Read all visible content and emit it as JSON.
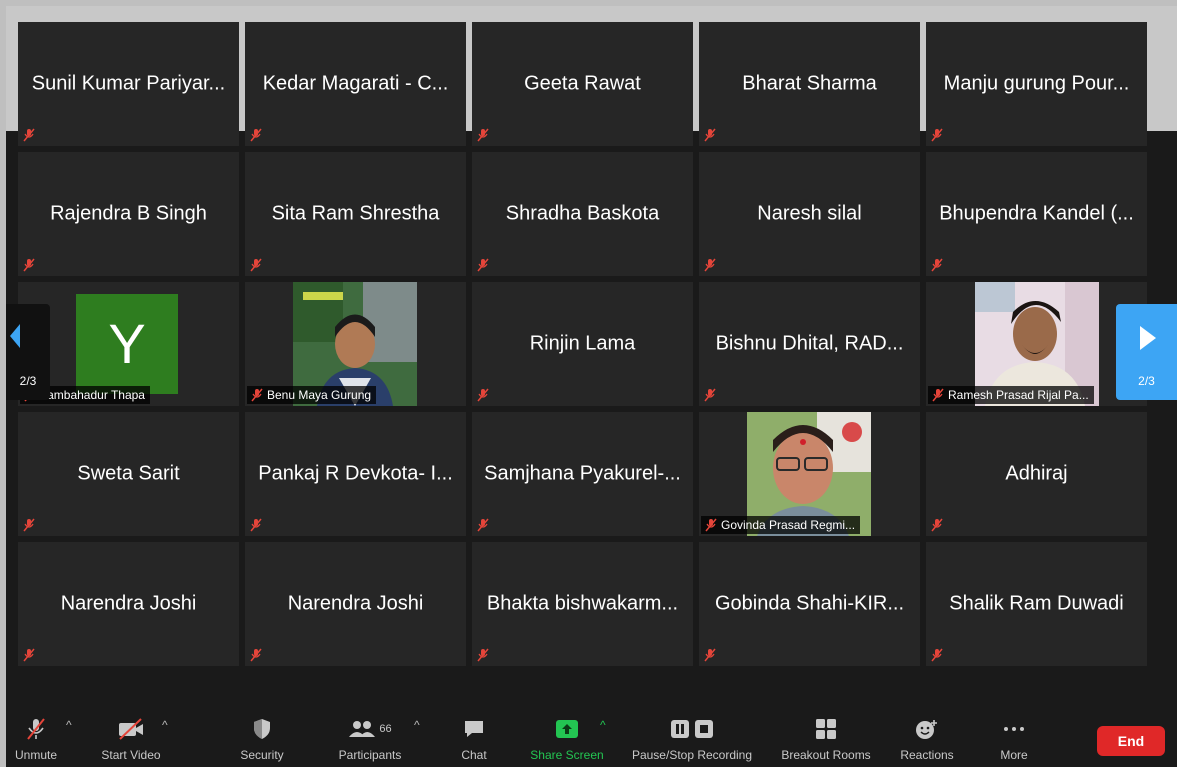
{
  "grid": {
    "tiles": [
      {
        "name": "Sunil Kumar Pariyar..."
      },
      {
        "name": "Kedar Magarati - C..."
      },
      {
        "name": "Geeta Rawat"
      },
      {
        "name": "Bharat Sharma"
      },
      {
        "name": "Manju gurung Pour..."
      },
      {
        "name": "Rajendra B Singh"
      },
      {
        "name": "Sita Ram Shrestha"
      },
      {
        "name": "Shradha Baskota"
      },
      {
        "name": "Naresh silal"
      },
      {
        "name": "Bhupendra Kandel (..."
      },
      {
        "name": "Yambahadur Thapa",
        "avatar_letter": "Y"
      },
      {
        "name": "Benu Maya Gurung"
      },
      {
        "name": "Rinjin Lama"
      },
      {
        "name": "Bishnu Dhital, RAD..."
      },
      {
        "name": "Ramesh Prasad Rijal Pa..."
      },
      {
        "name": "Sweta Sarit"
      },
      {
        "name": "Pankaj R Devkota- I..."
      },
      {
        "name": "Samjhana Pyakurel-..."
      },
      {
        "name": "Govinda Prasad Regmi..."
      },
      {
        "name": "Adhiraj"
      },
      {
        "name": "Narendra Joshi"
      },
      {
        "name": "Narendra Joshi"
      },
      {
        "name": "Bhakta bishwakarm..."
      },
      {
        "name": "Gobinda Shahi-KIR..."
      },
      {
        "name": "Shalik Ram Duwadi"
      }
    ]
  },
  "pager": {
    "left_page": "2/3",
    "right_page": "2/3"
  },
  "toolbar": {
    "unmute": "Unmute",
    "start_video": "Start Video",
    "security": "Security",
    "participants": "Participants",
    "participants_count": "66",
    "chat": "Chat",
    "share_screen": "Share Screen",
    "recording": "Pause/Stop Recording",
    "breakout": "Breakout Rooms",
    "reactions": "Reactions",
    "more": "More",
    "end": "End"
  },
  "colors": {
    "muted_red": "#e5453a",
    "share_green": "#23c552",
    "end_red": "#e02828",
    "nav_blue": "#3da5f4"
  }
}
